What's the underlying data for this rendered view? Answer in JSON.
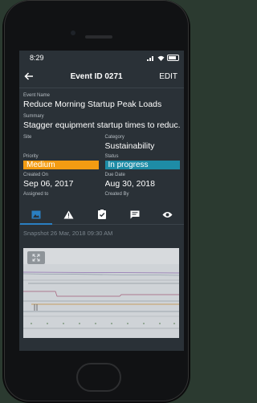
{
  "statusbar": {
    "time": "8:29"
  },
  "header": {
    "title": "Event ID 0271",
    "edit_label": "EDIT"
  },
  "fields": {
    "event_name": {
      "label": "Event Name",
      "value": "Reduce Morning Startup Peak Loads"
    },
    "summary": {
      "label": "Summary",
      "value": "Stagger equipment startup times to reduc..."
    },
    "site": {
      "label": "Site",
      "value": ""
    },
    "category": {
      "label": "Category",
      "value": "Sustainability"
    },
    "priority": {
      "label": "Priority",
      "value": "Medium"
    },
    "status": {
      "label": "Status",
      "value": "In progress"
    },
    "created_on": {
      "label": "Created On",
      "value": "Sep 06, 2017"
    },
    "due_date": {
      "label": "Due Date",
      "value": "Aug 30, 2018"
    },
    "assigned_to": {
      "label": "Assigned to",
      "value": ""
    },
    "created_by": {
      "label": "Created By",
      "value": ""
    }
  },
  "tabs": [
    {
      "icon": "image-icon",
      "active": true
    },
    {
      "icon": "warning-icon",
      "active": false
    },
    {
      "icon": "checklist-icon",
      "active": false
    },
    {
      "icon": "comment-icon",
      "active": false
    },
    {
      "icon": "eye-icon",
      "active": false
    }
  ],
  "snapshot": {
    "label": "Snapshot 26 Mar, 2018 09:30 AM"
  },
  "colors": {
    "screen_bg": "#2a3137",
    "priority_badge": "#f39c12",
    "status_badge": "#1e8ca6",
    "tab_accent": "#2a7fc2"
  }
}
